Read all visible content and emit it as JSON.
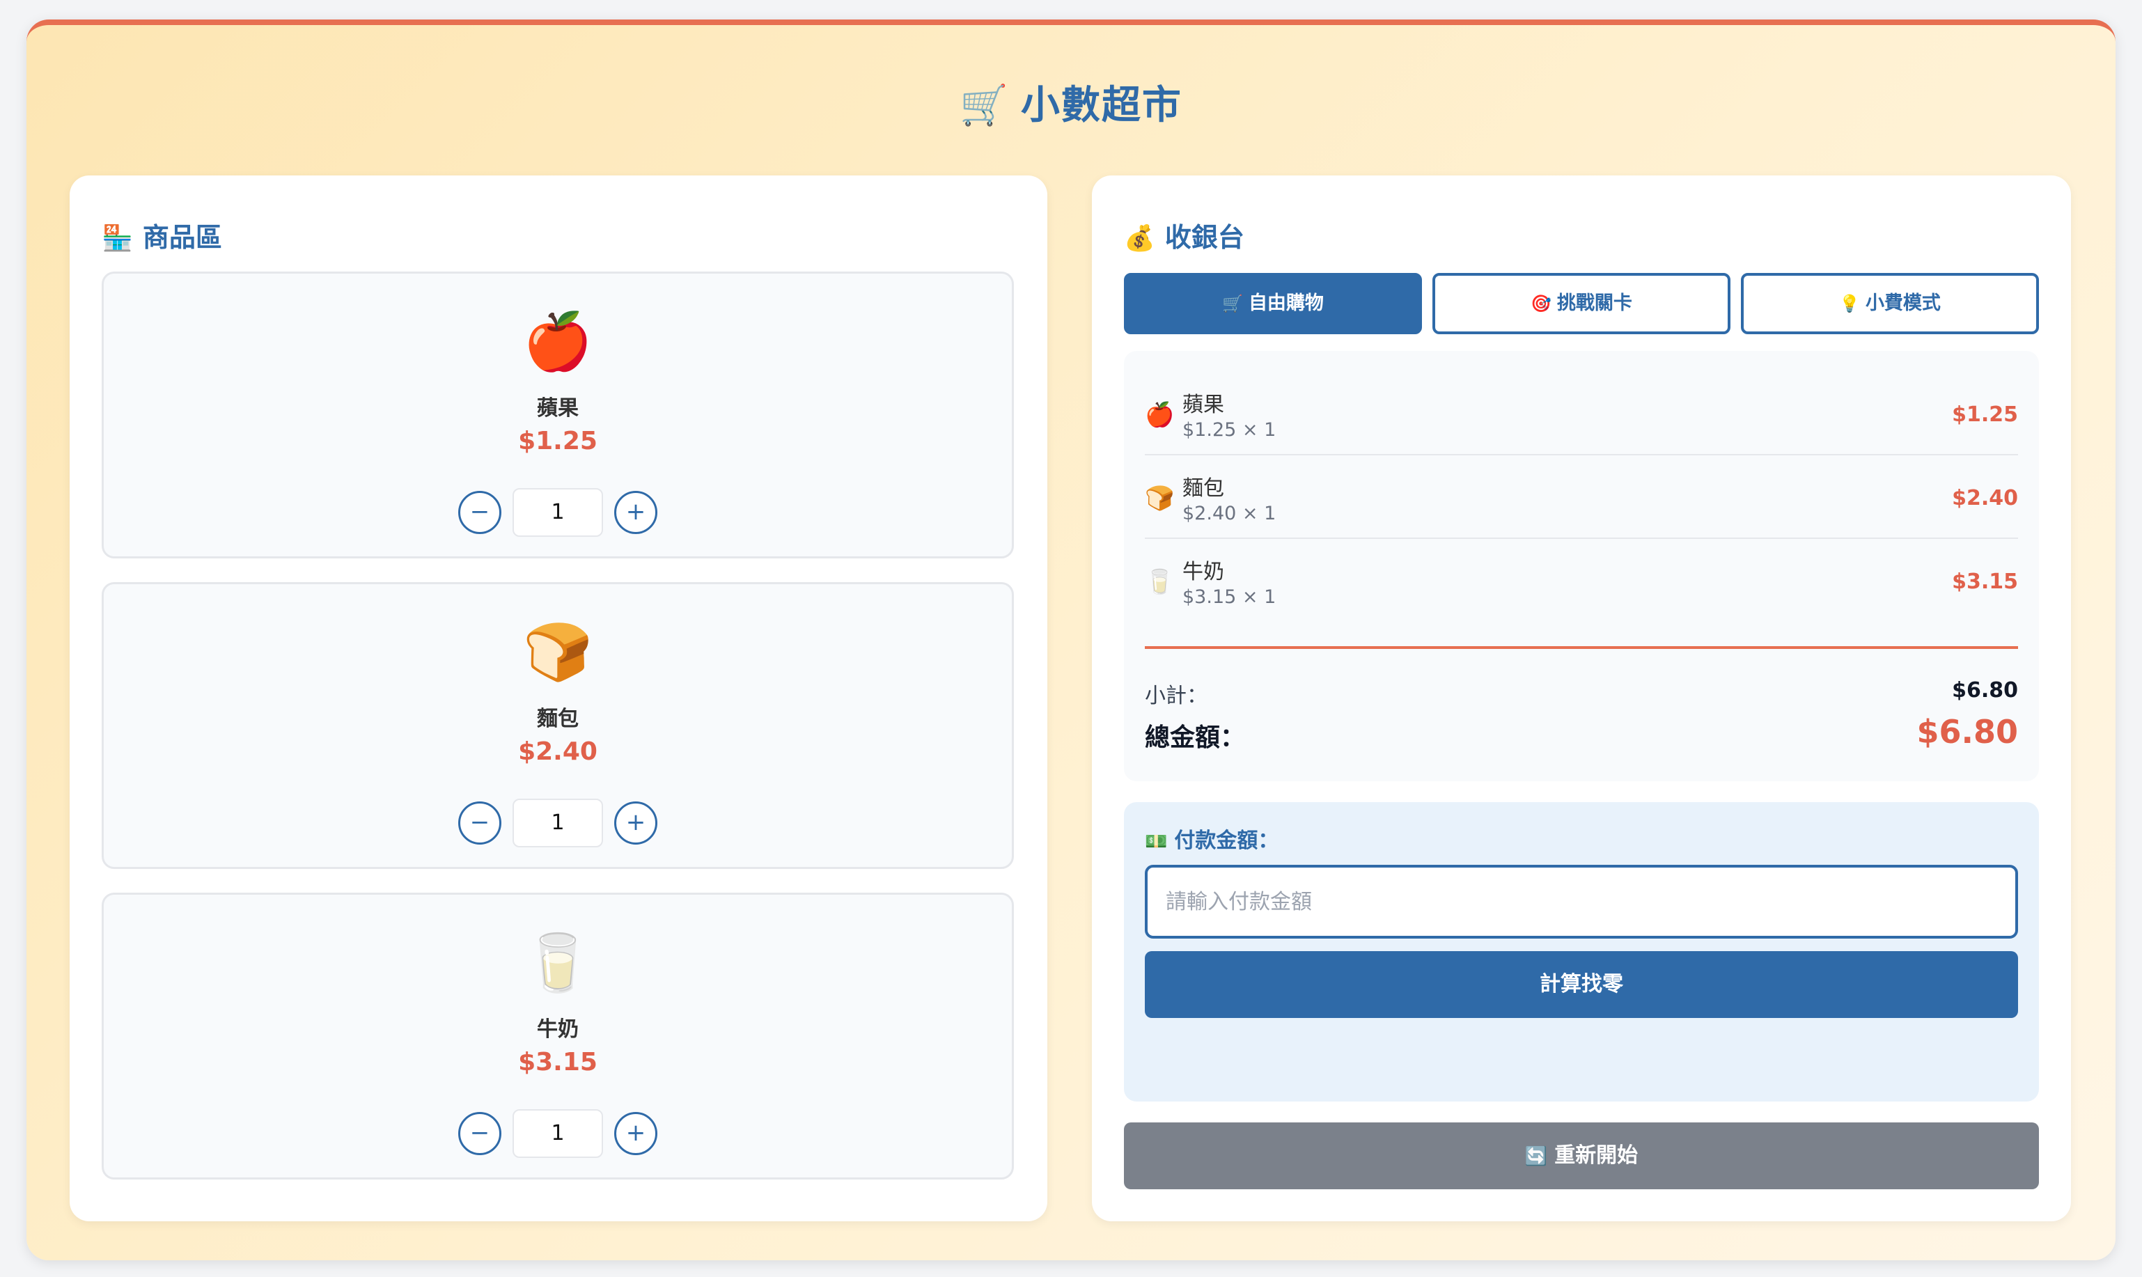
{
  "app": {
    "title": "小數超市",
    "title_icon": "🛒"
  },
  "products_panel": {
    "title": "商品區",
    "title_icon": "🏪",
    "items": [
      {
        "emoji": "🍎",
        "name": "蘋果",
        "price": "$1.25",
        "quantity": "1",
        "minus": "−",
        "plus": "+"
      },
      {
        "emoji": "🍞",
        "name": "麵包",
        "price": "$2.40",
        "quantity": "1",
        "minus": "−",
        "plus": "+"
      },
      {
        "emoji": "🥛",
        "name": "牛奶",
        "price": "$3.15",
        "quantity": "1",
        "minus": "−",
        "plus": "+"
      }
    ]
  },
  "checkout_panel": {
    "title": "收銀台",
    "title_icon": "💰",
    "modes": [
      {
        "icon": "🛒",
        "label": "自由購物",
        "active": true
      },
      {
        "icon": "🎯",
        "label": "挑戰關卡",
        "active": false
      },
      {
        "icon": "💡",
        "label": "小費模式",
        "active": false
      }
    ],
    "receipt": {
      "items": [
        {
          "emoji": "🍎",
          "name": "蘋果",
          "calc": "$1.25 × 1",
          "total": "$1.25"
        },
        {
          "emoji": "🍞",
          "name": "麵包",
          "calc": "$2.40 × 1",
          "total": "$2.40"
        },
        {
          "emoji": "🥛",
          "name": "牛奶",
          "calc": "$3.15 × 1",
          "total": "$3.15"
        }
      ],
      "subtotal_label": "小計：",
      "subtotal_value": "$6.80",
      "total_label": "總金額：",
      "total_value": "$6.80"
    },
    "payment": {
      "icon": "💵",
      "label": "付款金額：",
      "input_value": "",
      "input_placeholder": "請輸入付款金額",
      "calculate_label": "計算找零"
    },
    "reset": {
      "icon": "🔄",
      "label": "重新開始"
    }
  },
  "colors": {
    "primary": "#2f6aa8",
    "accent": "#e0604a",
    "reset_gray": "#7b818b",
    "payment_bg": "#e8f2fb"
  }
}
